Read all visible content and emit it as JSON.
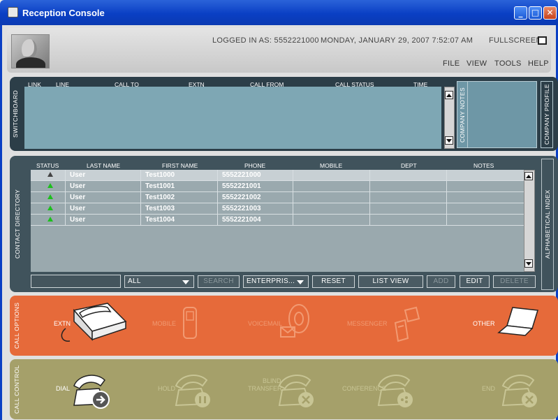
{
  "window": {
    "title": "Reception Console"
  },
  "header": {
    "logged_in": "LOGGED IN AS: 5552221000",
    "datetime": "MONDAY, JANUARY 29, 2007 7:52:07 AM",
    "fullscreen": "FULLSCREEN",
    "menu": [
      "FILE",
      "VIEW",
      "TOOLS",
      "HELP"
    ]
  },
  "switchboard": {
    "label": "SWITCHBOARD",
    "columns": [
      "LINK",
      "LINE",
      "CALL TO",
      "EXTN",
      "CALL FROM",
      "CALL STATUS",
      "TIME"
    ],
    "company_notes": "COMPANY NOTES",
    "company_profile": "COMPANY PROFILE"
  },
  "contacts": {
    "label": "CONTACT DIRECTORY",
    "columns": [
      "STATUS",
      "LAST NAME",
      "FIRST NAME",
      "PHONE",
      "MOBILE",
      "DEPT",
      "NOTES"
    ],
    "rows": [
      {
        "status": "gray",
        "last": "User",
        "first": "Test1000",
        "phone": "5552221000"
      },
      {
        "status": "green",
        "last": "User",
        "first": "Test1001",
        "phone": "5552221001"
      },
      {
        "status": "green",
        "last": "User",
        "first": "Test1002",
        "phone": "5552221002"
      },
      {
        "status": "green",
        "last": "User",
        "first": "Test1003",
        "phone": "5552221003"
      },
      {
        "status": "green",
        "last": "User",
        "first": "Test1004",
        "phone": "5552221004"
      }
    ],
    "alpha_index": "ALPHABETICAL INDEX",
    "filter_value": "ALL",
    "search": "SEARCH",
    "scope_value": "ENTERPRIS...",
    "reset": "RESET",
    "list_view": "LIST VIEW",
    "add": "ADD",
    "edit": "EDIT",
    "delete": "DELETE"
  },
  "call_options": {
    "label": "CALL OPTIONS",
    "items": [
      "EXTN",
      "MOBILE",
      "VOICEMAIL",
      "MESSENGER",
      "OTHER"
    ]
  },
  "call_control": {
    "label": "CALL CONTROL",
    "dial": "DIAL",
    "hold": "HOLD",
    "blind": "BLIND",
    "transfer": "TRANSFER",
    "conference": "CONFERENCE",
    "end": "END"
  }
}
